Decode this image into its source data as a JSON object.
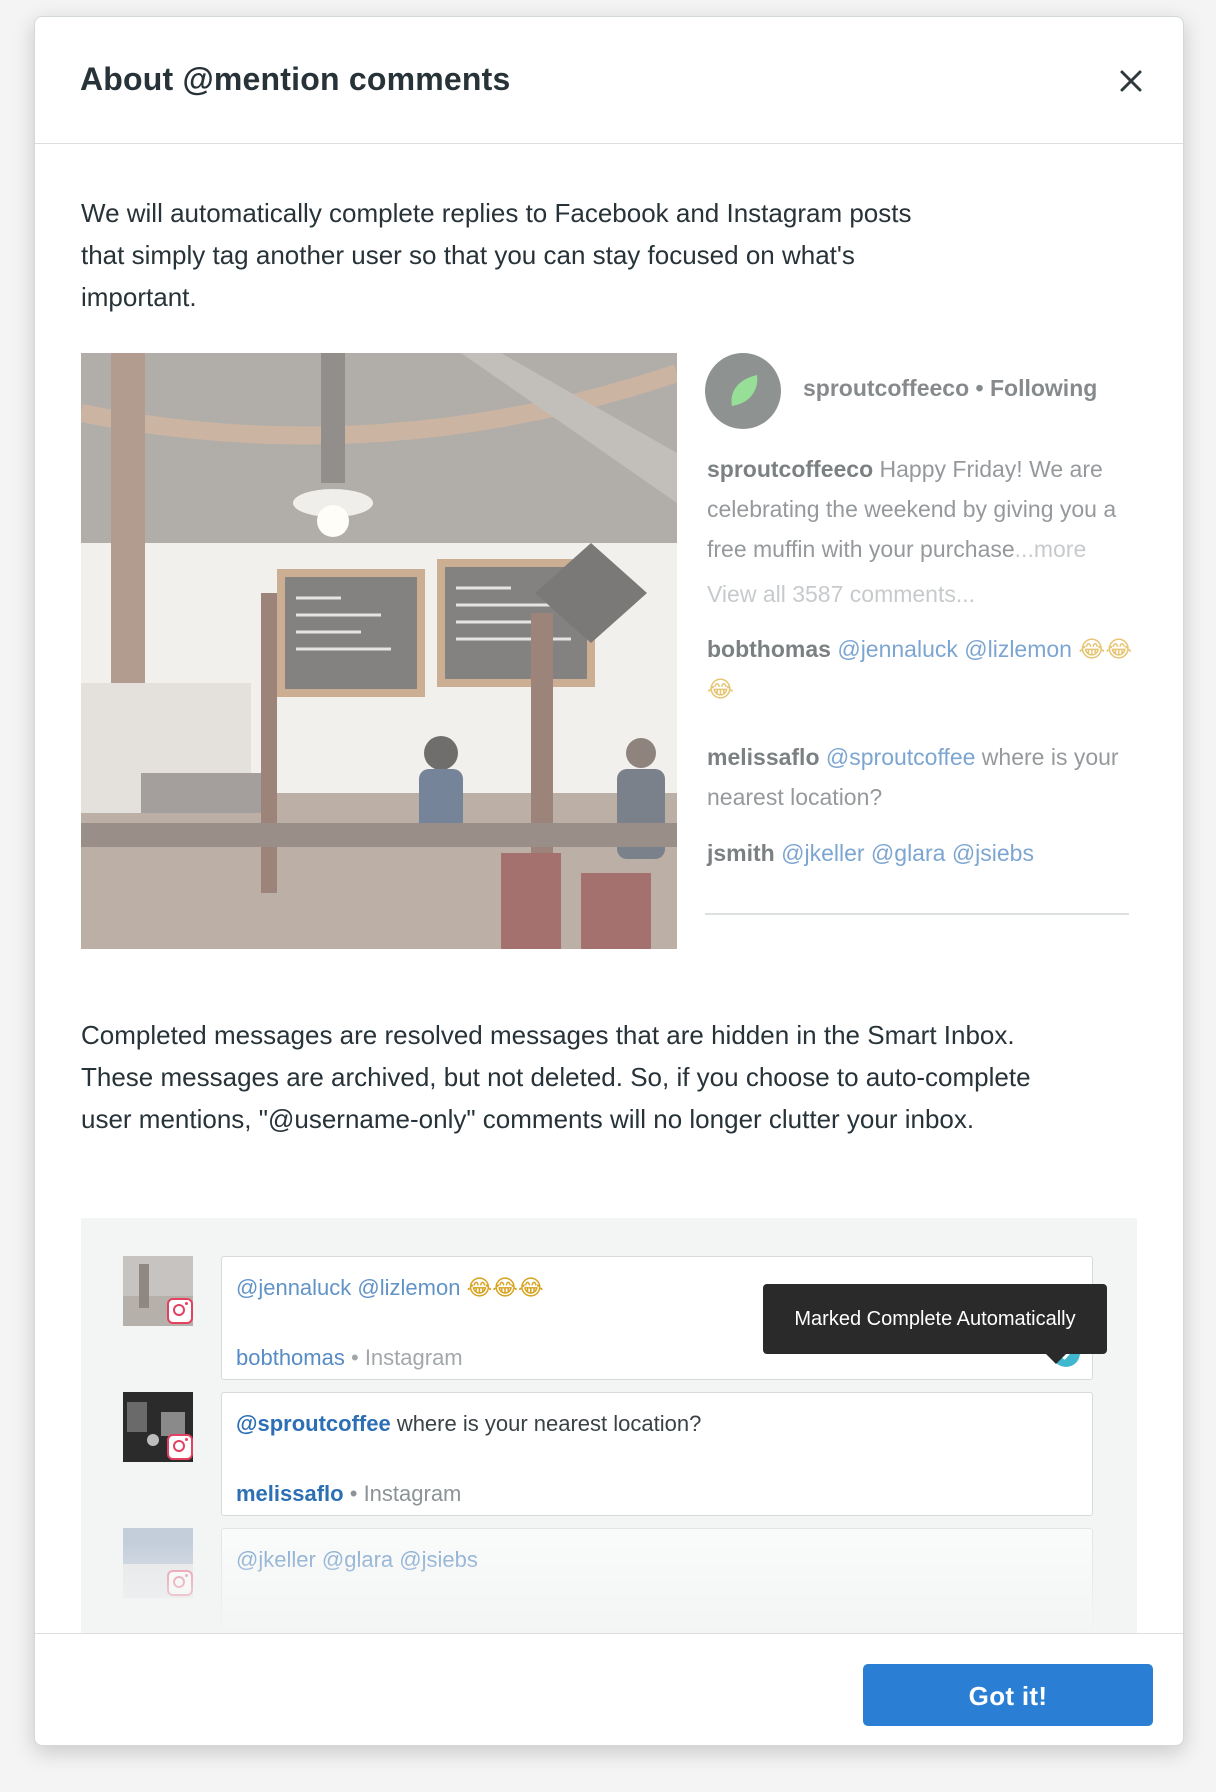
{
  "modal": {
    "title": "About @mention comments",
    "close_icon": "close-icon",
    "intro": "We will automatically complete replies to Facebook and Instagram posts that simply tag another user so that you can stay focused on what's important.",
    "explanation": "Completed messages are resolved messages that are hidden in the Smart Inbox. These messages are archived, but not deleted. So, if you choose to auto-complete user mentions, \"@username-only\" comments will no longer clutter your inbox.",
    "confirm_label": "Got it!"
  },
  "instagram_post": {
    "account": "sproutcoffeeco",
    "following": "Following",
    "separator": "•",
    "caption": "Happy Friday! We are celebrating the weekend by giving you a free muffin with your purchase",
    "more": "...more",
    "view_all": "View all 3587 comments...",
    "comments": [
      {
        "author": "bobthomas",
        "mentions": "@jennaluck @lizlemon",
        "text": "",
        "emoji": "😂😂😂"
      },
      {
        "author": "melissaflo",
        "mentions": "@sproutcoffee",
        "text": "where is your nearest location?",
        "emoji": ""
      },
      {
        "author": "jsmith",
        "mentions": "@jkeller @glara @jsiebs",
        "text": "",
        "emoji": ""
      }
    ]
  },
  "inbox": {
    "tooltip": "Marked Complete Automatically",
    "messages": [
      {
        "mentions": "@jennaluck @lizlemon",
        "text": "",
        "emoji": "😂😂😂",
        "author": "bobthomas",
        "network": "Instagram",
        "separator": "•",
        "status": "completed"
      },
      {
        "mentions": "@sproutcoffee",
        "text": "where is your nearest location?",
        "emoji": "",
        "author": "melissaflo",
        "network": "Instagram",
        "separator": "•",
        "status": "open"
      },
      {
        "mentions": "@jkeller @glara @jsiebs",
        "text": "",
        "emoji": "",
        "author": "",
        "network": "",
        "separator": "",
        "status": "faded"
      }
    ]
  },
  "colors": {
    "accent": "#2a7fd4",
    "mention": "#2d6fb5",
    "check": "#3eb7cf",
    "instagram": "#e4405f",
    "tooltip_bg": "#2a2a2a"
  }
}
